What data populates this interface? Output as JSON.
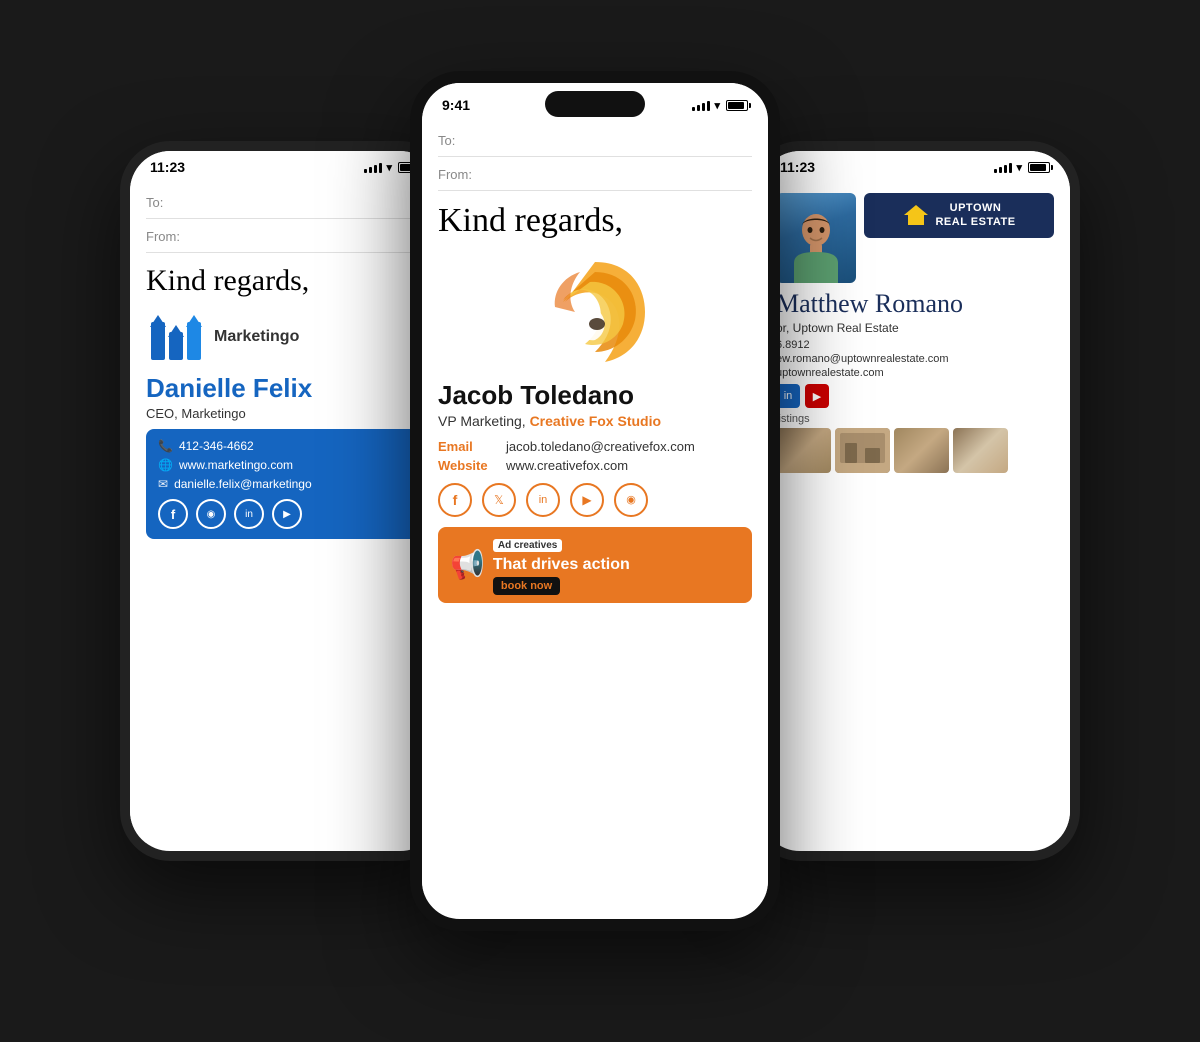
{
  "background": "#1a1a1a",
  "phones": {
    "left": {
      "time": "11:23",
      "email": {
        "to": "To:",
        "from": "From:"
      },
      "greeting": "Kind regards,",
      "logo_text": "Marketingo",
      "name": "Danielle Felix",
      "title": "CEO, Marketingo",
      "phone": "412-346-4662",
      "website": "www.marketingo.com",
      "email_addr": "danielle.felix@marketingo",
      "social": [
        "f",
        "📷",
        "in",
        "▶"
      ]
    },
    "center": {
      "time": "9:41",
      "email": {
        "to": "To:",
        "from": "From:"
      },
      "greeting": "Kind regards,",
      "name": "Jacob Toledano",
      "title_pre": "VP Marketing, ",
      "title_company": "Creative Fox Studio",
      "email_label": "Email",
      "email_value": "jacob.toledano@creativefox.com",
      "website_label": "Website",
      "website_value": "www.creativefox.com",
      "social": [
        "f",
        "t",
        "in",
        "▶",
        "📷"
      ],
      "ad": {
        "small_text": "Ad creatives",
        "main_text": "That drives action",
        "cta": "book now"
      }
    },
    "right": {
      "time": "11:23",
      "greeting": "Matthew Romano",
      "title": "or, Uptown Real Estate",
      "phone": "6.8912",
      "email": "ew.romano@uptownrealestate.com",
      "website": "uptownrealestate.com",
      "listings_label": "listings",
      "uptown_line1": "UPTOWN",
      "uptown_line2": "REAL ESTATE"
    }
  },
  "icons": {
    "phone": "📞",
    "globe": "🌐",
    "email": "✉",
    "facebook": "f",
    "instagram": "📷",
    "linkedin": "in",
    "youtube": "▶",
    "twitter": "t",
    "megaphone": "📢"
  }
}
